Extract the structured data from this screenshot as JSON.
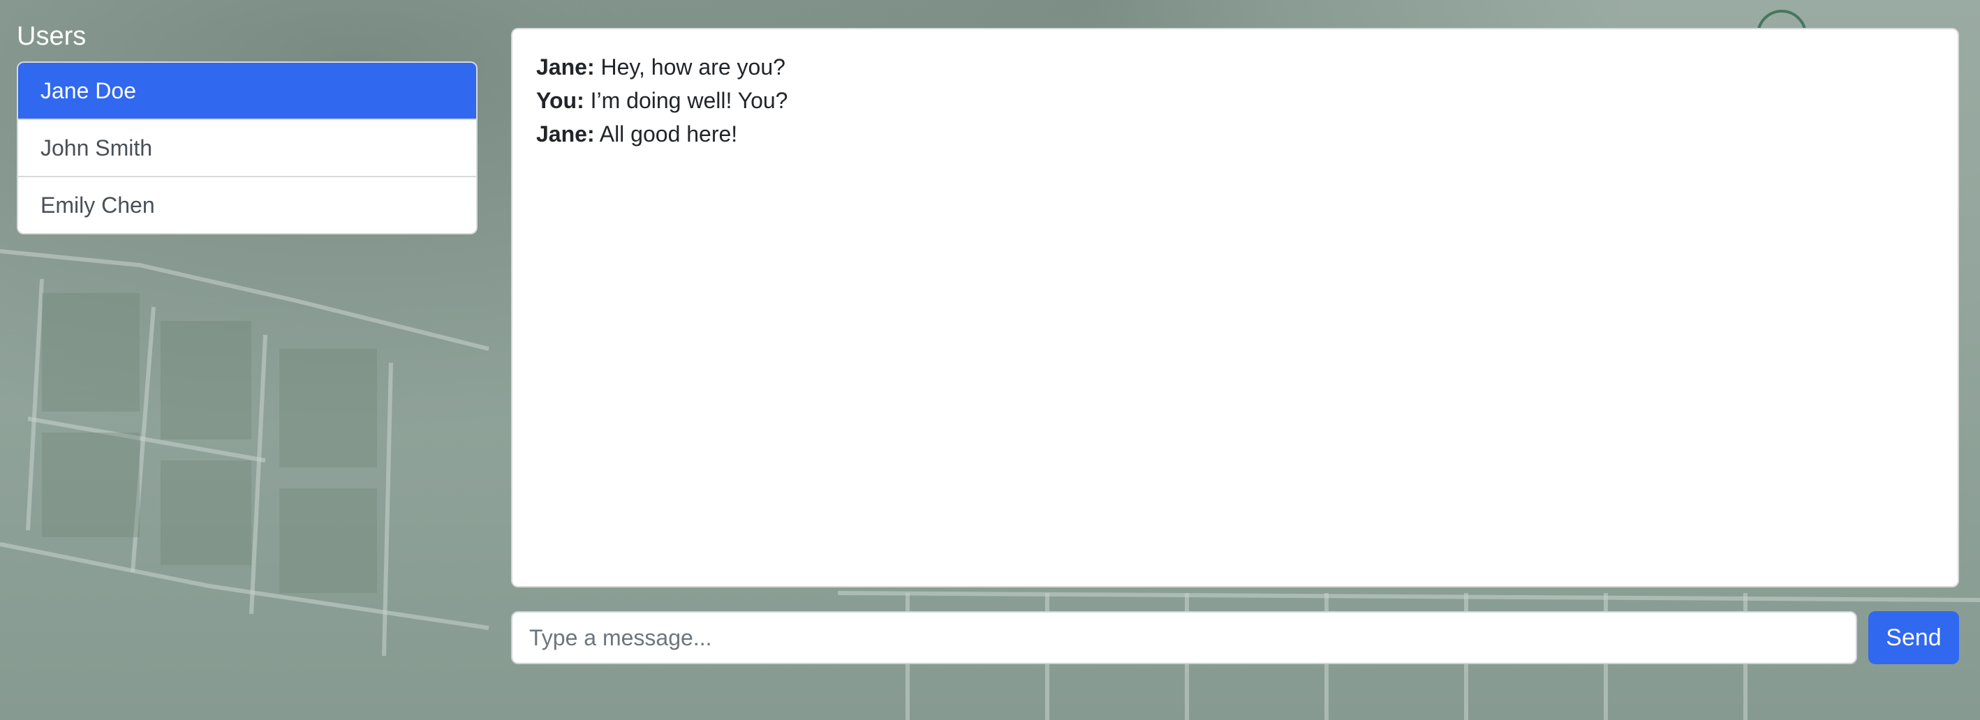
{
  "sidebar": {
    "heading": "Users",
    "users": [
      {
        "name": "Jane Doe",
        "active": true
      },
      {
        "name": "John Smith",
        "active": false
      },
      {
        "name": "Emily Chen",
        "active": false
      }
    ]
  },
  "chat": {
    "messages": [
      {
        "sender": "Jane:",
        "text": "Hey, how are you?"
      },
      {
        "sender": "You:",
        "text": "I’m doing well! You?"
      },
      {
        "sender": "Jane:",
        "text": "All good here!"
      }
    ]
  },
  "composer": {
    "placeholder": "Type a message...",
    "value": "",
    "send_label": "Send"
  },
  "colors": {
    "accent": "#3068f0",
    "background_tint": "#8fa39b"
  }
}
